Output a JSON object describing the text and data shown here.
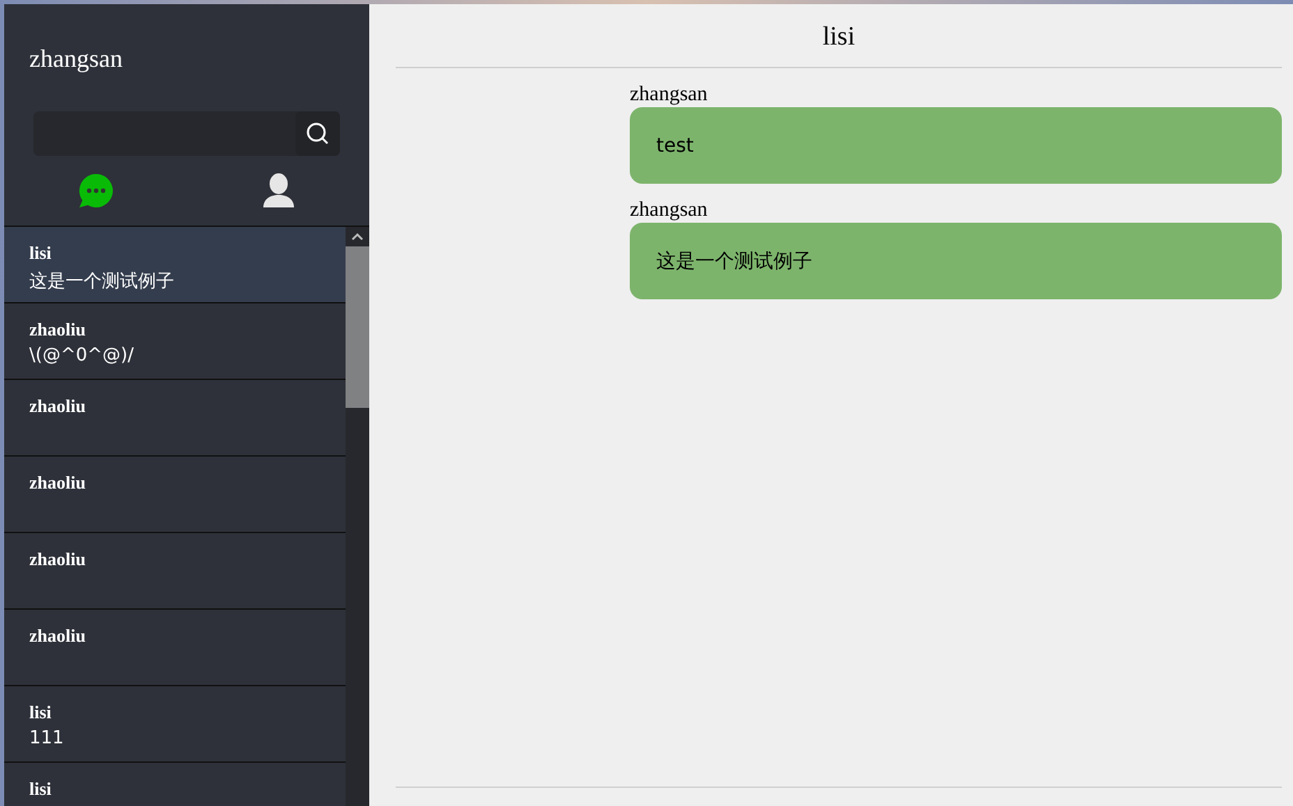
{
  "sidebar": {
    "user_name": "zhangsan",
    "tabs": [
      {
        "kind": "chat",
        "selected": true
      },
      {
        "kind": "contacts",
        "selected": false
      }
    ],
    "conversations": [
      {
        "name": "lisi",
        "last_message": "这是一个测试例子",
        "selected": true
      },
      {
        "name": "zhaoliu",
        "last_message": "\\(@^0^@)/",
        "selected": false
      },
      {
        "name": "zhaoliu",
        "selected": false
      },
      {
        "name": "zhaoliu",
        "selected": false
      },
      {
        "name": "zhaoliu",
        "selected": false
      },
      {
        "name": "zhaoliu",
        "selected": false
      },
      {
        "name": "lisi",
        "last_message": "111",
        "selected": false
      },
      {
        "name": "lisi",
        "selected": false
      }
    ]
  },
  "chat": {
    "title": "lisi",
    "messages": [
      {
        "sender": "zhangsan",
        "text": "test"
      },
      {
        "sender": "zhangsan",
        "text": "这是一个测试例子"
      }
    ]
  }
}
